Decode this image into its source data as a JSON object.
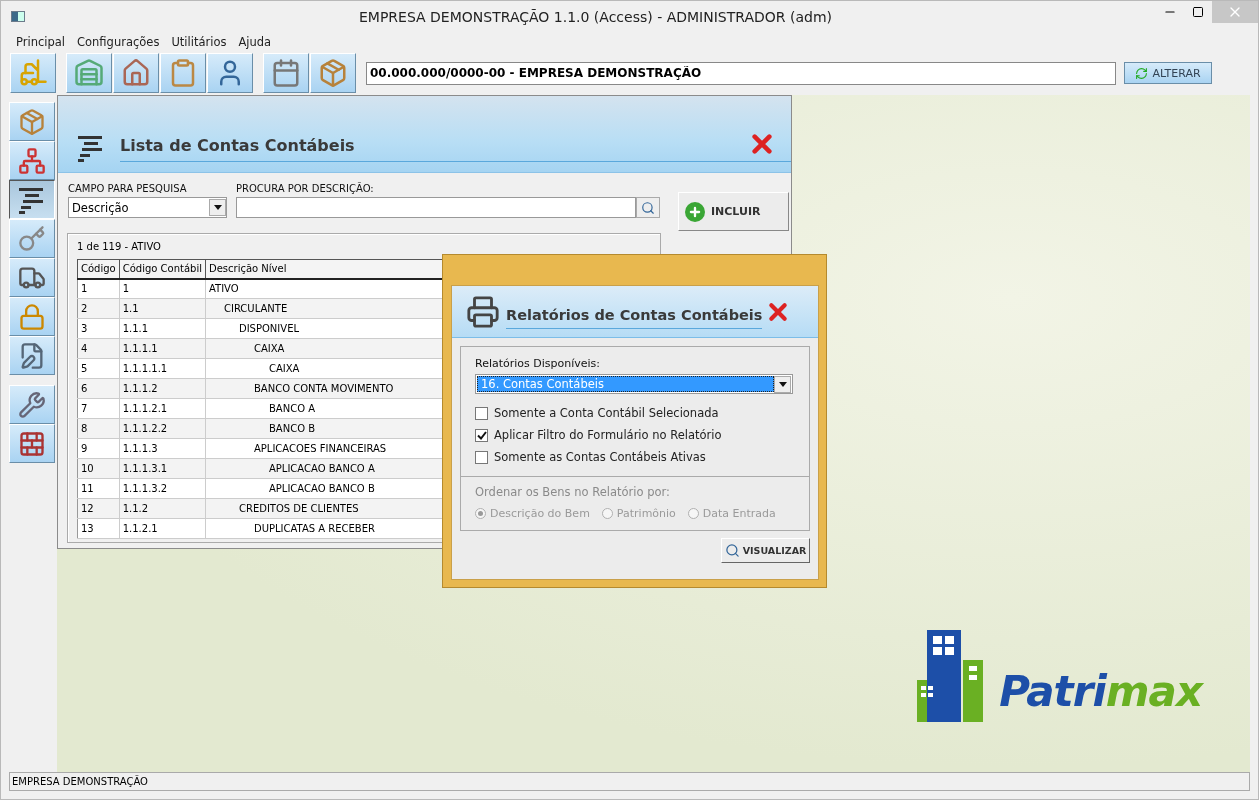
{
  "window": {
    "title": "EMPRESA DEMONSTRAÇÃO 1.1.0 (Access) - ADMINISTRADOR (adm)"
  },
  "menu": [
    {
      "label": "Principal"
    },
    {
      "label": "Configurações"
    },
    {
      "label": "Utilitários"
    },
    {
      "label": "Ajuda"
    }
  ],
  "company_bar": {
    "value": "00.000.000/0000-00 - EMPRESA DEMONSTRAÇÃO",
    "button": "ALTERAR"
  },
  "sidebar": {
    "items": [
      {
        "selected": false
      },
      {
        "selected": false
      },
      {
        "selected": true
      },
      {
        "selected": false
      },
      {
        "selected": false
      },
      {
        "selected": false
      },
      {
        "selected": false
      },
      {
        "selected": false
      },
      {
        "selected": false
      }
    ]
  },
  "list_window": {
    "title": "Lista de Contas Contábeis",
    "search_field_label": "CAMPO PARA PESQUISA",
    "search_field_value": "Descrição",
    "search_label": "PROCURA POR DESCRIÇÃO:",
    "add_button": "INCLUIR",
    "record_info": "1 de 119 - ATIVO",
    "columns": [
      "Código",
      "Código Contábil",
      "Descrição Nível"
    ],
    "rows": [
      {
        "code": "1",
        "account": "1",
        "description": "ATIVO",
        "children": [
          {
            "code": "2",
            "account": "1.1",
            "description": "CIRCULANTE",
            "children": [
              {
                "code": "3",
                "account": "1.1.1",
                "description": "DISPONIVEL",
                "children": [
                  {
                    "code": "4",
                    "account": "1.1.1.1",
                    "description": "CAIXA",
                    "children": [
                      {
                        "code": "5",
                        "account": "1.1.1.1.1",
                        "description": "CAIXA"
                      }
                    ]
                  },
                  {
                    "code": "6",
                    "account": "1.1.1.2",
                    "description": "BANCO CONTA MOVIMENTO",
                    "children": [
                      {
                        "code": "7",
                        "account": "1.1.1.2.1",
                        "description": "BANCO A"
                      },
                      {
                        "code": "8",
                        "account": "1.1.1.2.2",
                        "description": "BANCO B"
                      }
                    ]
                  },
                  {
                    "code": "9",
                    "account": "1.1.1.3",
                    "description": "APLICACOES FINANCEIRAS",
                    "children": [
                      {
                        "code": "10",
                        "account": "1.1.1.3.1",
                        "description": "APLICACAO BANCO A"
                      },
                      {
                        "code": "11",
                        "account": "1.1.1.3.2",
                        "description": "APLICACAO BANCO B"
                      }
                    ]
                  }
                ]
              },
              {
                "code": "12",
                "account": "1.1.2",
                "description": "CREDITOS DE CLIENTES",
                "children": [
                  {
                    "code": "13",
                    "account": "1.1.2.1",
                    "description": "DUPLICATAS A RECEBER"
                  }
                ]
              }
            ]
          }
        ]
      }
    ]
  },
  "report_dialog": {
    "title": "Relatórios de Contas Contábeis",
    "reports_label": "Relatórios Disponíveis:",
    "report_value": "16. Contas Contábeis",
    "options": [
      {
        "label": "Somente a Conta Contábil Selecionada",
        "checked": false
      },
      {
        "label": "Aplicar Filtro do Formulário no Relatório",
        "checked": true
      },
      {
        "label": "Somente as Contas Contábeis Ativas",
        "checked": false
      }
    ],
    "order_label": "Ordenar os Bens no Relatório por:",
    "order_disabled": true,
    "order_options": [
      {
        "label": "Descrição do Bem",
        "selected": true
      },
      {
        "label": "Patrimônio",
        "selected": false
      },
      {
        "label": "Data Entrada",
        "selected": false
      }
    ],
    "view_button": "VISUALIZAR"
  },
  "logo": {
    "first": "Patri",
    "second": "max"
  },
  "status_bar": {
    "text": "EMPRESA DEMONSTRAÇÃO"
  }
}
